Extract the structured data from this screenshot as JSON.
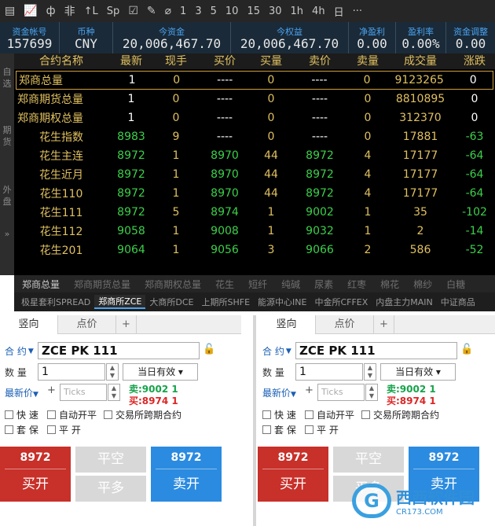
{
  "toolbar": {
    "items": [
      "▤",
      "📈",
      "ф",
      "非",
      "↑L",
      "Sp",
      "☑",
      "✎",
      "⌀",
      "1",
      "3",
      "5",
      "10",
      "15",
      "30",
      "1h",
      "4h",
      "日",
      "···"
    ]
  },
  "account": [
    {
      "label": "资金帐号",
      "value": "157699"
    },
    {
      "label": "币种",
      "value": "CNY"
    },
    {
      "label": "今资金",
      "value": "20,006,467.70"
    },
    {
      "label": "今权益",
      "value": "20,006,467.70"
    },
    {
      "label": "净盈利",
      "value": "0.00"
    },
    {
      "label": "盈利率",
      "value": "0.00%"
    },
    {
      "label": "资金调整",
      "value": "0.00"
    }
  ],
  "side_tabs": [
    "自选",
    "期货",
    "外盘",
    "»"
  ],
  "quote_table": {
    "headers": [
      "合约名称",
      "最新",
      "现手",
      "买价",
      "买量",
      "卖价",
      "卖量",
      "成交量",
      "涨跌"
    ],
    "rows": [
      [
        "郑商总量",
        "1",
        "0",
        "----",
        "0",
        "----",
        "0",
        "9123265",
        "0"
      ],
      [
        "郑商期货总量",
        "1",
        "0",
        "----",
        "0",
        "----",
        "0",
        "8810895",
        "0"
      ],
      [
        "郑商期权总量",
        "1",
        "0",
        "----",
        "0",
        "----",
        "0",
        "312370",
        "0"
      ],
      [
        "花生指数",
        "8983",
        "9",
        "----",
        "0",
        "----",
        "0",
        "17881",
        "-63"
      ],
      [
        "花生主连",
        "8972",
        "1",
        "8970",
        "44",
        "8972",
        "4",
        "17177",
        "-64"
      ],
      [
        "花生近月",
        "8972",
        "1",
        "8970",
        "44",
        "8972",
        "4",
        "17177",
        "-64"
      ],
      [
        "花生110",
        "8972",
        "1",
        "8970",
        "44",
        "8972",
        "4",
        "17177",
        "-64"
      ],
      [
        "花生111",
        "8972",
        "5",
        "8974",
        "1",
        "9002",
        "1",
        "35",
        "-102"
      ],
      [
        "花生112",
        "9058",
        "1",
        "9008",
        "1",
        "9032",
        "1",
        "2",
        "-14"
      ],
      [
        "花生201",
        "9064",
        "1",
        "9056",
        "3",
        "9066",
        "2",
        "586",
        "-52"
      ]
    ]
  },
  "colors": {
    "name": "#e0c060",
    "up": "#ffffff",
    "yellow": "#e0c060",
    "green": "#3cd04a",
    "red": "#e84040"
  },
  "product_tabs": [
    "郑商总量",
    "郑商期货总量",
    "郑商期权总量",
    "花生",
    "短纤",
    "纯碱",
    "尿素",
    "红枣",
    "棉花",
    "棉纱",
    "白糖"
  ],
  "exchange_tabs": [
    "极星套利SPREAD",
    "郑商所ZCE",
    "大商所DCE",
    "上期所SHFE",
    "能源中心INE",
    "中金所CFFEX",
    "内盘主力MAIN",
    "中证商品"
  ],
  "order_panel": {
    "tab_active": "竖向",
    "tab_other": "点价",
    "tab_plus": "+",
    "contract_label": "合 约",
    "contract_value": "ZCE PK 111",
    "qty_label": "数 量",
    "qty_value": "1",
    "validity": "当日有效",
    "price_label": "最新价",
    "tick_placeholder": "Ticks",
    "sell_quote": "卖:9002  1",
    "buy_quote": "买:8974  1",
    "chk_fast": "快 速",
    "chk_auto": "自动开平",
    "chk_cross": "交易所跨期合约",
    "chk_hedge": "套 保",
    "chk_flat": "平 开",
    "buy_price": "8972",
    "buy_label": "买开",
    "close_short": "平空",
    "close_long": "平多",
    "sell_price": "8972",
    "sell_label": "卖开"
  },
  "watermark": {
    "logo": "G",
    "title": "西西软件园",
    "url": "CR173.COM"
  }
}
